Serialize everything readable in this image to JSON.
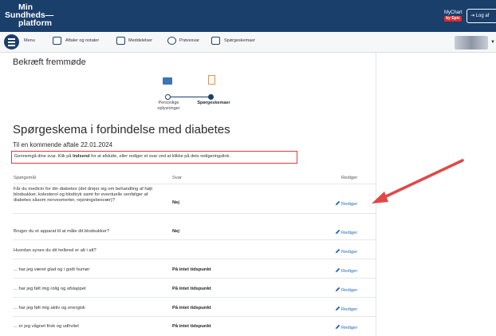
{
  "header": {
    "logo_lines": [
      "Min",
      "Sundheds—",
      "platform"
    ],
    "mychart_label": "MyChart",
    "mychart_sub": "by Epic",
    "logout_label": "Log af"
  },
  "nav": {
    "menu_label": "Menu",
    "items": [
      {
        "label": "Aftaler og notater",
        "icon": "calendar-icon"
      },
      {
        "label": "Meddelelser",
        "icon": "envelope-icon"
      },
      {
        "label": "Prøvesvar",
        "icon": "flask-icon"
      },
      {
        "label": "Spørgeskemaer",
        "icon": "checklist-icon"
      }
    ]
  },
  "page": {
    "title": "Bekræft fremmøde",
    "steps": [
      {
        "label": "Personlige oplysninger",
        "active": false
      },
      {
        "label": "Spørgeskemaer",
        "active": true
      }
    ],
    "form_title": "Spørgeskema i forbindelse med diabetes",
    "subtitle": "Til en kommende aftale 22.01.2024",
    "instruction_pre": "Gennemgå dine svar. Klik på ",
    "instruction_bold": "Indsend",
    "instruction_post": " for at afslutte, eller rediger et svar ved at klikke på dets redigeringslink."
  },
  "table": {
    "headers": {
      "question": "Spørgsmål",
      "answer": "Svar",
      "edit": "Rediger"
    },
    "edit_label": "Rediger",
    "rows": [
      {
        "question": "Får du medicin for din diabetes (det drejer sig om behandling af højt blodsukker, kolesterol og blodtryk samt for eventuelle senfølger af diabetes såsom nervesmerter, rejsningsbesvær)?",
        "answer": "Nej"
      },
      {
        "question": "Bruger du et apparat til at måle dit blodsukker?",
        "answer": "Nej"
      },
      {
        "question": "Hvordan synes du dit helbred er alt i alt?",
        "answer": ""
      },
      {
        "question": "... har jeg været glad og i godt humør",
        "answer": "På intet tidspunkt"
      },
      {
        "question": "... har jeg følt mig rolig og afslappet",
        "answer": "På intet tidspunkt"
      },
      {
        "question": "... har jeg følt mig aktiv og energisk",
        "answer": "På intet tidspunkt"
      },
      {
        "question": "... er jeg vågnet frisk og udhvilet",
        "answer": "På intet tidspunkt"
      }
    ]
  },
  "colors": {
    "brand_navy": "#1b3f6b",
    "highlight_red": "#e23b3b",
    "link_blue": "#2a6bb8"
  }
}
